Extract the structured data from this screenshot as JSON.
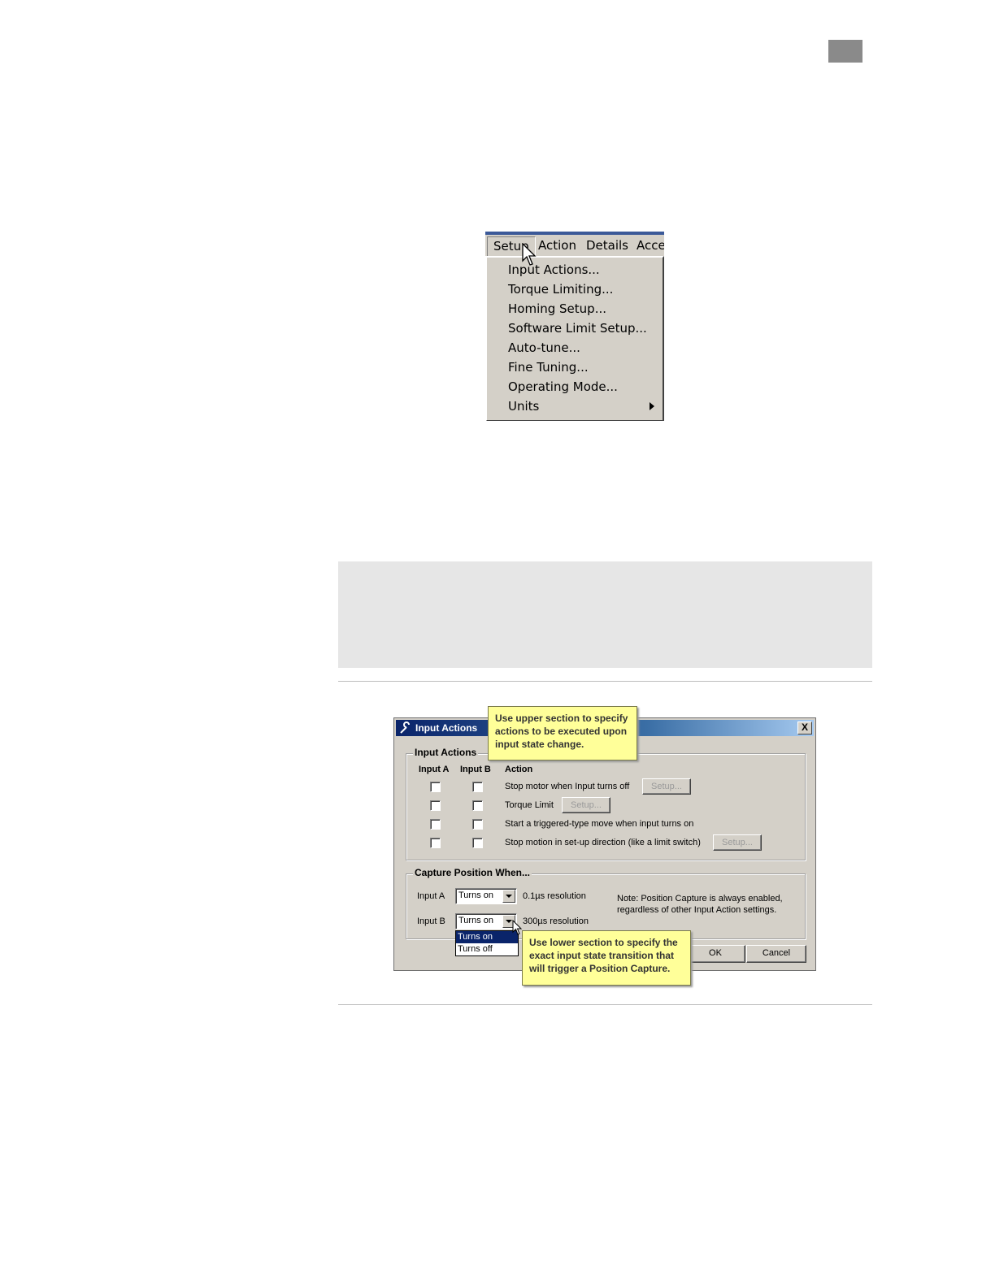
{
  "menu_screenshot": {
    "menubar": [
      "Setup",
      "Action",
      "Details",
      "Acce"
    ],
    "items": [
      {
        "label": "Input Actions..."
      },
      {
        "label": "Torque Limiting..."
      },
      {
        "label": "Homing Setup..."
      },
      {
        "label": "Software Limit Setup..."
      },
      {
        "label": "Auto-tune..."
      },
      {
        "label": "Fine Tuning..."
      },
      {
        "label": "Operating Mode..."
      },
      {
        "label": "Units",
        "submenu": true
      }
    ]
  },
  "dialog": {
    "title": "Input Actions",
    "close_label": "X",
    "input_actions": {
      "title": "Input Actions",
      "col_a": "Input A",
      "col_b": "Input B",
      "col_action": "Action",
      "rows": [
        {
          "action": "Stop motor when Input turns off",
          "button": "Setup..."
        },
        {
          "action": "Torque Limit",
          "button": "Setup..."
        },
        {
          "action": "Start a triggered-type move when input turns on"
        },
        {
          "action": "Stop motion in set-up direction (like a limit switch)",
          "button": "Setup..."
        }
      ]
    },
    "capture": {
      "title": "Capture Position When...",
      "input_a_label": "Input A",
      "input_a_value": "Turns on",
      "input_a_resolution": "0.1µs resolution",
      "input_b_label": "Input B",
      "input_b_value": "Turns on",
      "input_b_resolution": "300µs resolution",
      "note_line1": "Note: Position Capture is always enabled,",
      "note_line2": "regardless of other Input Action settings.",
      "options": [
        "Turns on",
        "Turns off"
      ]
    },
    "ok_label": "OK",
    "cancel_label": "Cancel",
    "callout_upper": {
      "line1": "Use upper section to specify",
      "line2": "actions to be executed upon",
      "line3": "input state change."
    },
    "callout_lower": {
      "line1": "Use lower section to specify the",
      "line2": "exact input state transition  that",
      "line3": "will  trigger a Position Capture."
    }
  }
}
